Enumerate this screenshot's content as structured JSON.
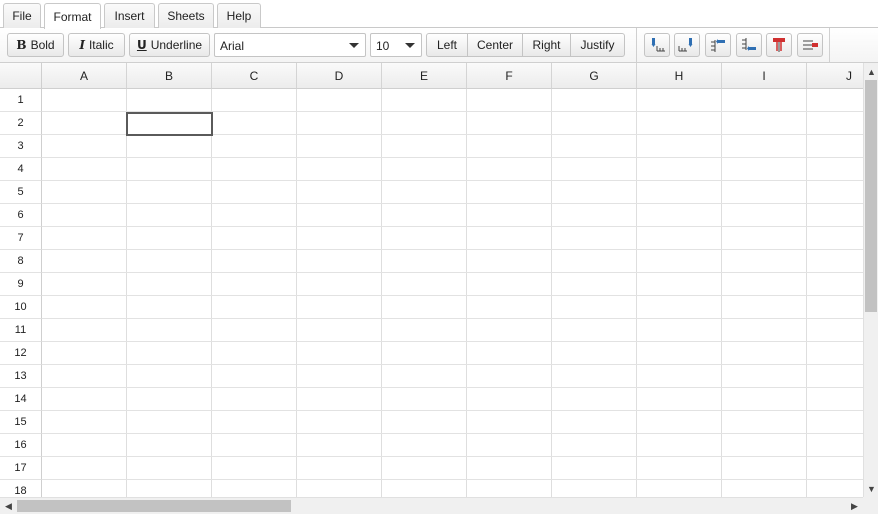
{
  "tabs": [
    {
      "label": "File"
    },
    {
      "label": "Format"
    },
    {
      "label": "Insert"
    },
    {
      "label": "Sheets"
    },
    {
      "label": "Help"
    }
  ],
  "toolbar": {
    "bold_label": "Bold",
    "italic_label": "Italic",
    "underline_label": "Underline",
    "bold_glyph": "B",
    "italic_glyph": "I",
    "underline_glyph": "U",
    "font_family": "Arial",
    "font_size": "10",
    "align": {
      "left": "Left",
      "center": "Center",
      "right": "Right",
      "justify": "Justify"
    },
    "icons": [
      "insert-column-left-icon",
      "insert-column-right-icon",
      "insert-row-above-icon",
      "insert-row-below-icon",
      "delete-column-icon",
      "delete-row-icon"
    ]
  },
  "sheet": {
    "columns": [
      "A",
      "B",
      "C",
      "D",
      "E",
      "F",
      "G",
      "H",
      "I",
      "J"
    ],
    "rows": [
      "1",
      "2",
      "3",
      "4",
      "5",
      "6",
      "7",
      "8",
      "9",
      "10",
      "11",
      "12",
      "13",
      "14",
      "15",
      "16",
      "17",
      "18"
    ],
    "selected_cell": "B2"
  },
  "colors": {
    "selection_border": "#5a5a5a",
    "scroll_thumb": "#c2c2c2",
    "icon_blue": "#2f6fb3",
    "icon_red": "#d03030"
  }
}
